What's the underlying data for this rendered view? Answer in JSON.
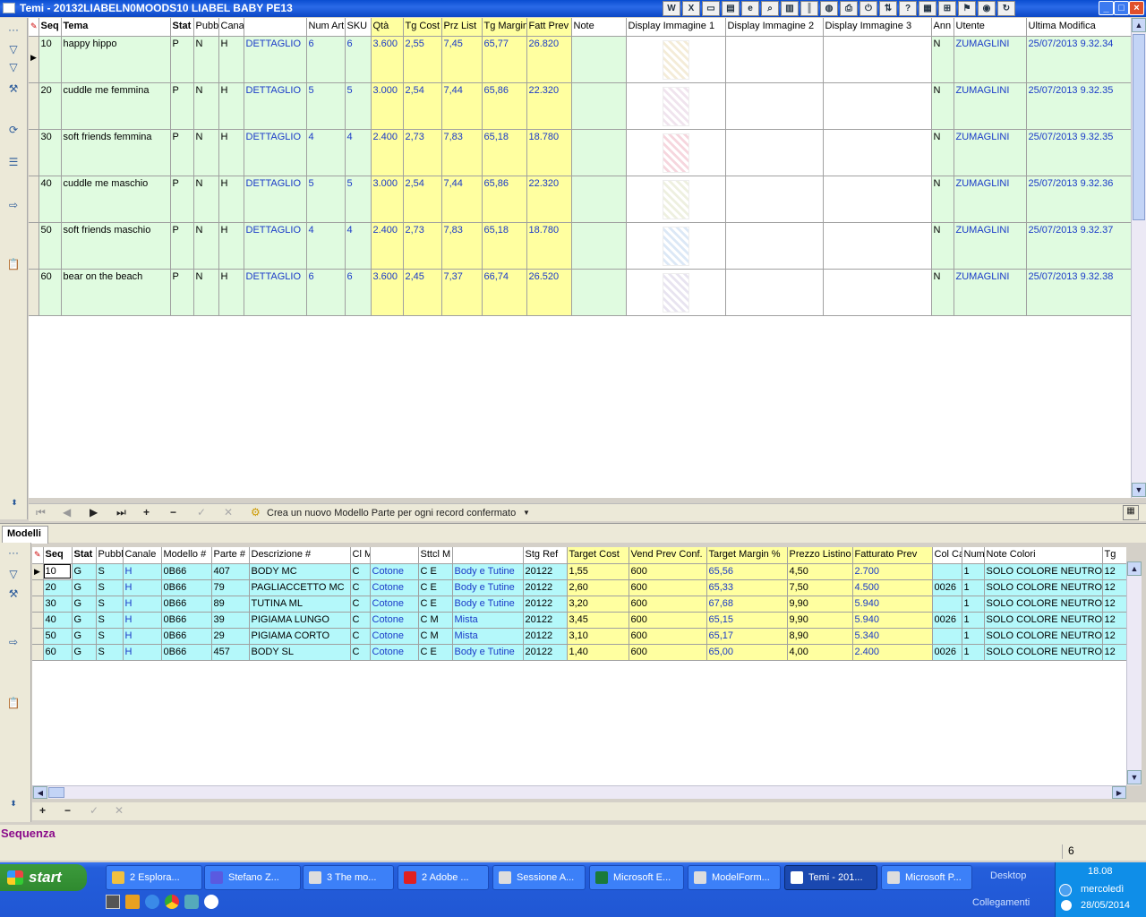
{
  "window": {
    "title": "Temi -  20132LIABELN0MOODS10 LIABEL BABY PE13"
  },
  "toolbar_icons": [
    "word-icon",
    "excel-icon",
    "window-icon",
    "folder-icon",
    "ie-icon",
    "find-icon",
    "chart-icon",
    "barcode-icon",
    "globe-icon",
    "printer-icon",
    "power-icon",
    "sort-icon",
    "help-icon",
    "report-icon",
    "grid-icon",
    "network-icon",
    "chrome-icon",
    "refresh-icon"
  ],
  "temi": {
    "headers": [
      "Seq",
      "Tema",
      "Stat",
      "Pubb",
      "Cana",
      "",
      "Num Art",
      "SKU",
      "Qtà",
      "Tg Cost",
      "Prz List",
      "Tg Margin",
      "Fatt Prev",
      "Note",
      "Display Immagine 1",
      "Display Immagine 2",
      "Display Immagine 3",
      "Ann",
      "Utente",
      "Ultima Modifica"
    ],
    "rows": [
      {
        "seq": "10",
        "tema": "happy hippo",
        "stat": "P",
        "pubb": "N",
        "cana": "H",
        "canale": "DETTAGLIO",
        "num_art": "6",
        "sku": "6",
        "qta": "3.600",
        "tg_cost": "2,55",
        "prz_list": "7,45",
        "tg_margin": "65,77",
        "fatt_prev": "26.820",
        "note": "",
        "ann": "N",
        "utente": "ZUMAGLINI",
        "ultima_modifica": "25/07/2013 9.32.34",
        "thumb_color": "#f4ecd8"
      },
      {
        "seq": "20",
        "tema": "cuddle me femmina",
        "stat": "P",
        "pubb": "N",
        "cana": "H",
        "canale": "DETTAGLIO",
        "num_art": "5",
        "sku": "5",
        "qta": "3.000",
        "tg_cost": "2,54",
        "prz_list": "7,44",
        "tg_margin": "65,86",
        "fatt_prev": "22.320",
        "note": "",
        "ann": "N",
        "utente": "ZUMAGLINI",
        "ultima_modifica": "25/07/2013 9.32.35",
        "thumb_color": "#f0e4ee"
      },
      {
        "seq": "30",
        "tema": "soft friends femmina",
        "stat": "P",
        "pubb": "N",
        "cana": "H",
        "canale": "DETTAGLIO",
        "num_art": "4",
        "sku": "4",
        "qta": "2.400",
        "tg_cost": "2,73",
        "prz_list": "7,83",
        "tg_margin": "65,18",
        "fatt_prev": "18.780",
        "note": "",
        "ann": "N",
        "utente": "ZUMAGLINI",
        "ultima_modifica": "25/07/2013 9.32.35",
        "thumb_color": "#f6d6de"
      },
      {
        "seq": "40",
        "tema": "cuddle me maschio",
        "stat": "P",
        "pubb": "N",
        "cana": "H",
        "canale": "DETTAGLIO",
        "num_art": "5",
        "sku": "5",
        "qta": "3.000",
        "tg_cost": "2,54",
        "prz_list": "7,44",
        "tg_margin": "65,86",
        "fatt_prev": "22.320",
        "note": "",
        "ann": "N",
        "utente": "ZUMAGLINI",
        "ultima_modifica": "25/07/2013 9.32.36",
        "thumb_color": "#eef0e0"
      },
      {
        "seq": "50",
        "tema": "soft friends maschio",
        "stat": "P",
        "pubb": "N",
        "cana": "H",
        "canale": "DETTAGLIO",
        "num_art": "4",
        "sku": "4",
        "qta": "2.400",
        "tg_cost": "2,73",
        "prz_list": "7,83",
        "tg_margin": "65,18",
        "fatt_prev": "18.780",
        "note": "",
        "ann": "N",
        "utente": "ZUMAGLINI",
        "ultima_modifica": "25/07/2013 9.32.37",
        "thumb_color": "#dce8f6"
      },
      {
        "seq": "60",
        "tema": "bear on the beach",
        "stat": "P",
        "pubb": "N",
        "cana": "H",
        "canale": "DETTAGLIO",
        "num_art": "6",
        "sku": "6",
        "qta": "3.600",
        "tg_cost": "2,45",
        "prz_list": "7,37",
        "tg_margin": "66,74",
        "fatt_prev": "26.520",
        "note": "",
        "ann": "N",
        "utente": "ZUMAGLINI",
        "ultima_modifica": "25/07/2013 9.32.38",
        "thumb_color": "#e8e4f0"
      }
    ]
  },
  "navbar": {
    "action_label": "Crea un nuovo Modello Parte per ogni record confermato"
  },
  "tab": {
    "label": "Modelli"
  },
  "modelli": {
    "headers": [
      "Seq",
      "Stat",
      "Pubbl",
      "Canale",
      "Modello #",
      "Parte #",
      "Descrizione #",
      "Cl M",
      "",
      "Sttcl M",
      "",
      "Stg Ref",
      "Target Cost",
      "Vend Prev Conf.",
      "Target Margin %",
      "Prezzo Listino",
      "Fatturato Prev",
      "Col Ca",
      "Num",
      "Note Colori",
      "Tg"
    ],
    "rows": [
      {
        "seq": "10",
        "stat": "G",
        "pubbl": "S",
        "canale": "H",
        "modello": "0B66",
        "parte": "407",
        "descrizione": "BODY MC",
        "cl": "C",
        "materiale": "Cotone",
        "sttcl": "C E",
        "tipo": "Body e Tutine",
        "stg_ref": "20122",
        "target_cost": "1,55",
        "vend_prev": "600",
        "target_margin": "65,56",
        "prezzo_listino": "4,50",
        "fatturato_prev": "2.700",
        "col_ca": "",
        "num": "1",
        "note_colori": "SOLO COLORE NEUTRO",
        "tg": "12"
      },
      {
        "seq": "20",
        "stat": "G",
        "pubbl": "S",
        "canale": "H",
        "modello": "0B66",
        "parte": "79",
        "descrizione": "PAGLIACCETTO MC",
        "cl": "C",
        "materiale": "Cotone",
        "sttcl": "C E",
        "tipo": "Body e Tutine",
        "stg_ref": "20122",
        "target_cost": "2,60",
        "vend_prev": "600",
        "target_margin": "65,33",
        "prezzo_listino": "7,50",
        "fatturato_prev": "4.500",
        "col_ca": "0026",
        "num": "1",
        "note_colori": "SOLO COLORE NEUTRO",
        "tg": "12"
      },
      {
        "seq": "30",
        "stat": "G",
        "pubbl": "S",
        "canale": "H",
        "modello": "0B66",
        "parte": "89",
        "descrizione": "TUTINA ML",
        "cl": "C",
        "materiale": "Cotone",
        "sttcl": "C E",
        "tipo": "Body e Tutine",
        "stg_ref": "20122",
        "target_cost": "3,20",
        "vend_prev": "600",
        "target_margin": "67,68",
        "prezzo_listino": "9,90",
        "fatturato_prev": "5.940",
        "col_ca": "",
        "num": "1",
        "note_colori": "SOLO COLORE NEUTRO",
        "tg": "12"
      },
      {
        "seq": "40",
        "stat": "G",
        "pubbl": "S",
        "canale": "H",
        "modello": "0B66",
        "parte": "39",
        "descrizione": "PIGIAMA LUNGO",
        "cl": "C",
        "materiale": "Cotone",
        "sttcl": "C M",
        "tipo": "Mista",
        "stg_ref": "20122",
        "target_cost": "3,45",
        "vend_prev": "600",
        "target_margin": "65,15",
        "prezzo_listino": "9,90",
        "fatturato_prev": "5.940",
        "col_ca": "0026",
        "num": "1",
        "note_colori": "SOLO COLORE NEUTRO",
        "tg": "12"
      },
      {
        "seq": "50",
        "stat": "G",
        "pubbl": "S",
        "canale": "H",
        "modello": "0B66",
        "parte": "29",
        "descrizione": "PIGIAMA CORTO",
        "cl": "C",
        "materiale": "Cotone",
        "sttcl": "C M",
        "tipo": "Mista",
        "stg_ref": "20122",
        "target_cost": "3,10",
        "vend_prev": "600",
        "target_margin": "65,17",
        "prezzo_listino": "8,90",
        "fatturato_prev": "5.340",
        "col_ca": "",
        "num": "1",
        "note_colori": "SOLO COLORE NEUTRO",
        "tg": "12"
      },
      {
        "seq": "60",
        "stat": "G",
        "pubbl": "S",
        "canale": "H",
        "modello": "0B66",
        "parte": "457",
        "descrizione": "BODY SL",
        "cl": "C",
        "materiale": "Cotone",
        "sttcl": "C E",
        "tipo": "Body e Tutine",
        "stg_ref": "20122",
        "target_cost": "1,40",
        "vend_prev": "600",
        "target_margin": "65,00",
        "prezzo_listino": "4,00",
        "fatturato_prev": "2.400",
        "col_ca": "0026",
        "num": "1",
        "note_colori": "SOLO COLORE NEUTRO",
        "tg": "12"
      }
    ]
  },
  "status": {
    "field_label": "Sequenza",
    "count": "6"
  },
  "taskbar": {
    "start_label": "start",
    "buttons": [
      "2 Esplora...",
      "Stefano Z...",
      "3 The mo...",
      "2 Adobe ...",
      "Sessione A...",
      "Microsoft E...",
      "ModelForm...",
      "Temi - 201...",
      "Microsoft P..."
    ],
    "toolbar_labels": [
      "Desktop",
      "Collegamenti"
    ],
    "clock": {
      "time": "18.08",
      "day": "mercoledì",
      "date": "28/05/2014"
    }
  },
  "colors": {
    "green": "#e0fbe0",
    "yellow": "#ffffa0",
    "cyan": "#b4f8fa",
    "title_blue": "#0a4dd0",
    "link_blue": "#1a3ac8"
  }
}
